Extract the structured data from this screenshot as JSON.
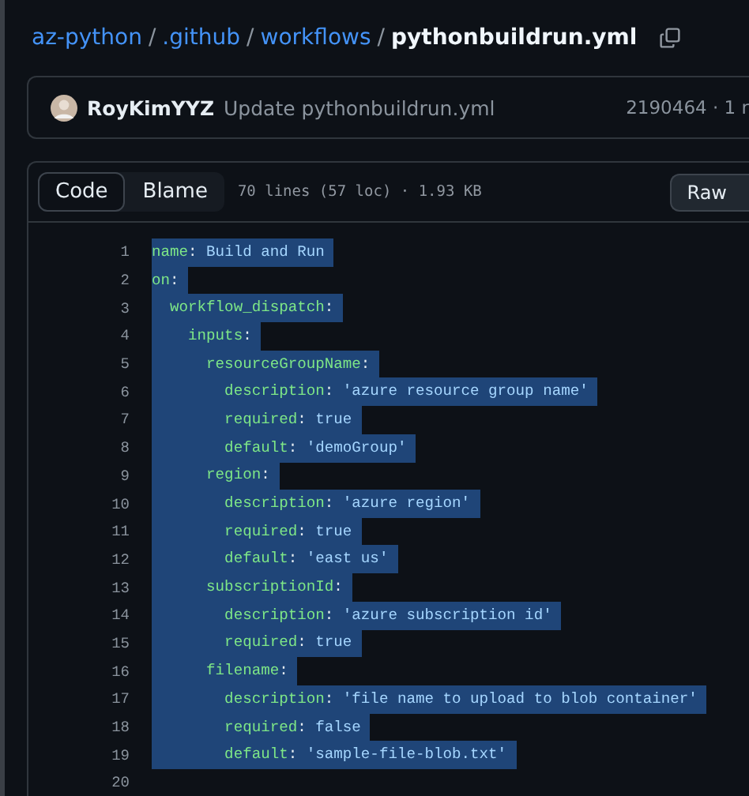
{
  "breadcrumb": {
    "parts": [
      {
        "label": "az-python"
      },
      {
        "label": ".github"
      },
      {
        "label": "workflows"
      }
    ],
    "separators": [
      "/",
      "/",
      "/"
    ],
    "file": "pythonbuildrun.yml"
  },
  "commit": {
    "author": "RoyKimYYZ",
    "message": "Update pythonbuildrun.yml",
    "meta": "2190464 · 1 r"
  },
  "tabs": [
    {
      "label": "Code",
      "selected": true
    },
    {
      "label": "Blame",
      "selected": false
    }
  ],
  "file_info": "70 lines (57 loc) · 1.93 KB",
  "raw_button": "Raw",
  "lines": [
    {
      "number": "1",
      "key": "name",
      "colon": ":",
      "value": " Build and Run",
      "selected": true
    },
    {
      "number": "2",
      "key": "on",
      "colon": ":",
      "selected": true
    },
    {
      "number": "3",
      "key": "  workflow_dispatch",
      "colon": ":",
      "selected": true
    },
    {
      "number": "4",
      "key": "    inputs",
      "colon": ":",
      "selected": true
    },
    {
      "number": "5",
      "key": "      resourceGroupName",
      "colon": ":",
      "selected": true
    },
    {
      "number": "6",
      "key": "        description",
      "colon": ":",
      "value": " 'azure resource group name'",
      "selected": true
    },
    {
      "number": "7",
      "key": "        required",
      "colon": ":",
      "value": " true",
      "selected": true
    },
    {
      "number": "8",
      "key": "        default",
      "colon": ":",
      "value": " 'demoGroup'",
      "selected": true
    },
    {
      "number": "9",
      "key": "      region",
      "colon": ":",
      "selected": true
    },
    {
      "number": "10",
      "key": "        description",
      "colon": ":",
      "value": " 'azure region'",
      "selected": true
    },
    {
      "number": "11",
      "key": "        required",
      "colon": ":",
      "value": " true",
      "selected": true
    },
    {
      "number": "12",
      "key": "        default",
      "colon": ":",
      "value": " 'east us'",
      "selected": true
    },
    {
      "number": "13",
      "key": "      subscriptionId",
      "colon": ":",
      "selected": true
    },
    {
      "number": "14",
      "key": "        description",
      "colon": ":",
      "value": " 'azure subscription id'",
      "selected": true
    },
    {
      "number": "15",
      "key": "        required",
      "colon": ":",
      "value": " true",
      "selected": true
    },
    {
      "number": "16",
      "key": "      filename",
      "colon": ":",
      "selected": true
    },
    {
      "number": "17",
      "key": "        description",
      "colon": ":",
      "value": " 'file name to upload to blob container'",
      "selected": true
    },
    {
      "number": "18",
      "key": "        required",
      "colon": ":",
      "value": " false",
      "selected": true
    },
    {
      "number": "19",
      "key": "        default",
      "colon": ":",
      "value": " 'sample-file-blob.txt'",
      "selected": true
    },
    {
      "number": "20"
    }
  ]
}
